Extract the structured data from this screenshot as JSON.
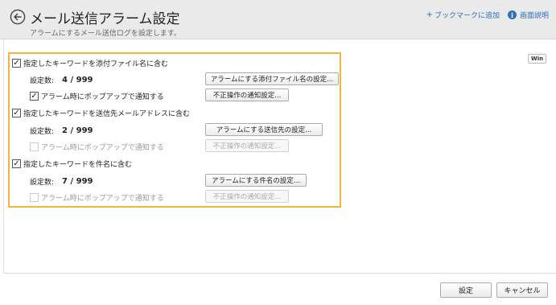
{
  "header": {
    "title": "メール送信アラーム設定",
    "subtitle": "アラームにするメール送信ログを設定します。",
    "bookmark_plus": "+",
    "bookmark_label": "ブックマークに追加",
    "help_icon_glyph": "i",
    "help_label": "画面説明"
  },
  "badge": {
    "win": "Win"
  },
  "sections": [
    {
      "checkbox_label": "指定したキーワードを添付ファイル名に含む",
      "checked": true,
      "count_label": "設定数:",
      "count_value": "4 / 999",
      "setting_button": "アラームにする添付ファイル名の設定...",
      "popup_label": "アラーム時にポップアップで通知する",
      "popup_checked": true,
      "popup_enabled": true,
      "notify_button": "不正操作の通知設定..."
    },
    {
      "checkbox_label": "指定したキーワードを送信先メールアドレスに含む",
      "checked": true,
      "count_label": "設定数:",
      "count_value": "2 / 999",
      "setting_button": "アラームにする送信先の設定...",
      "popup_label": "アラーム時にポップアップで通知する",
      "popup_checked": false,
      "popup_enabled": false,
      "notify_button": "不正操作の通知設定..."
    },
    {
      "checkbox_label": "指定したキーワードを件名に含む",
      "checked": true,
      "count_label": "設定数:",
      "count_value": "7 / 999",
      "setting_button": "アラームにする件名の設定...",
      "popup_label": "アラーム時にポップアップで通知する",
      "popup_checked": false,
      "popup_enabled": false,
      "notify_button": "不正操作の通知設定..."
    }
  ],
  "check_glyph": "✓",
  "footer": {
    "ok_label": "設定",
    "cancel_label": "キャンセル"
  },
  "colors": {
    "highlight_border": "#f0b53a",
    "link": "#2c6fbb",
    "header_bg": "#eaeaea"
  },
  "icons": {
    "back": "back-arrow-circle-icon",
    "info": "info-icon",
    "check": "check-icon"
  }
}
